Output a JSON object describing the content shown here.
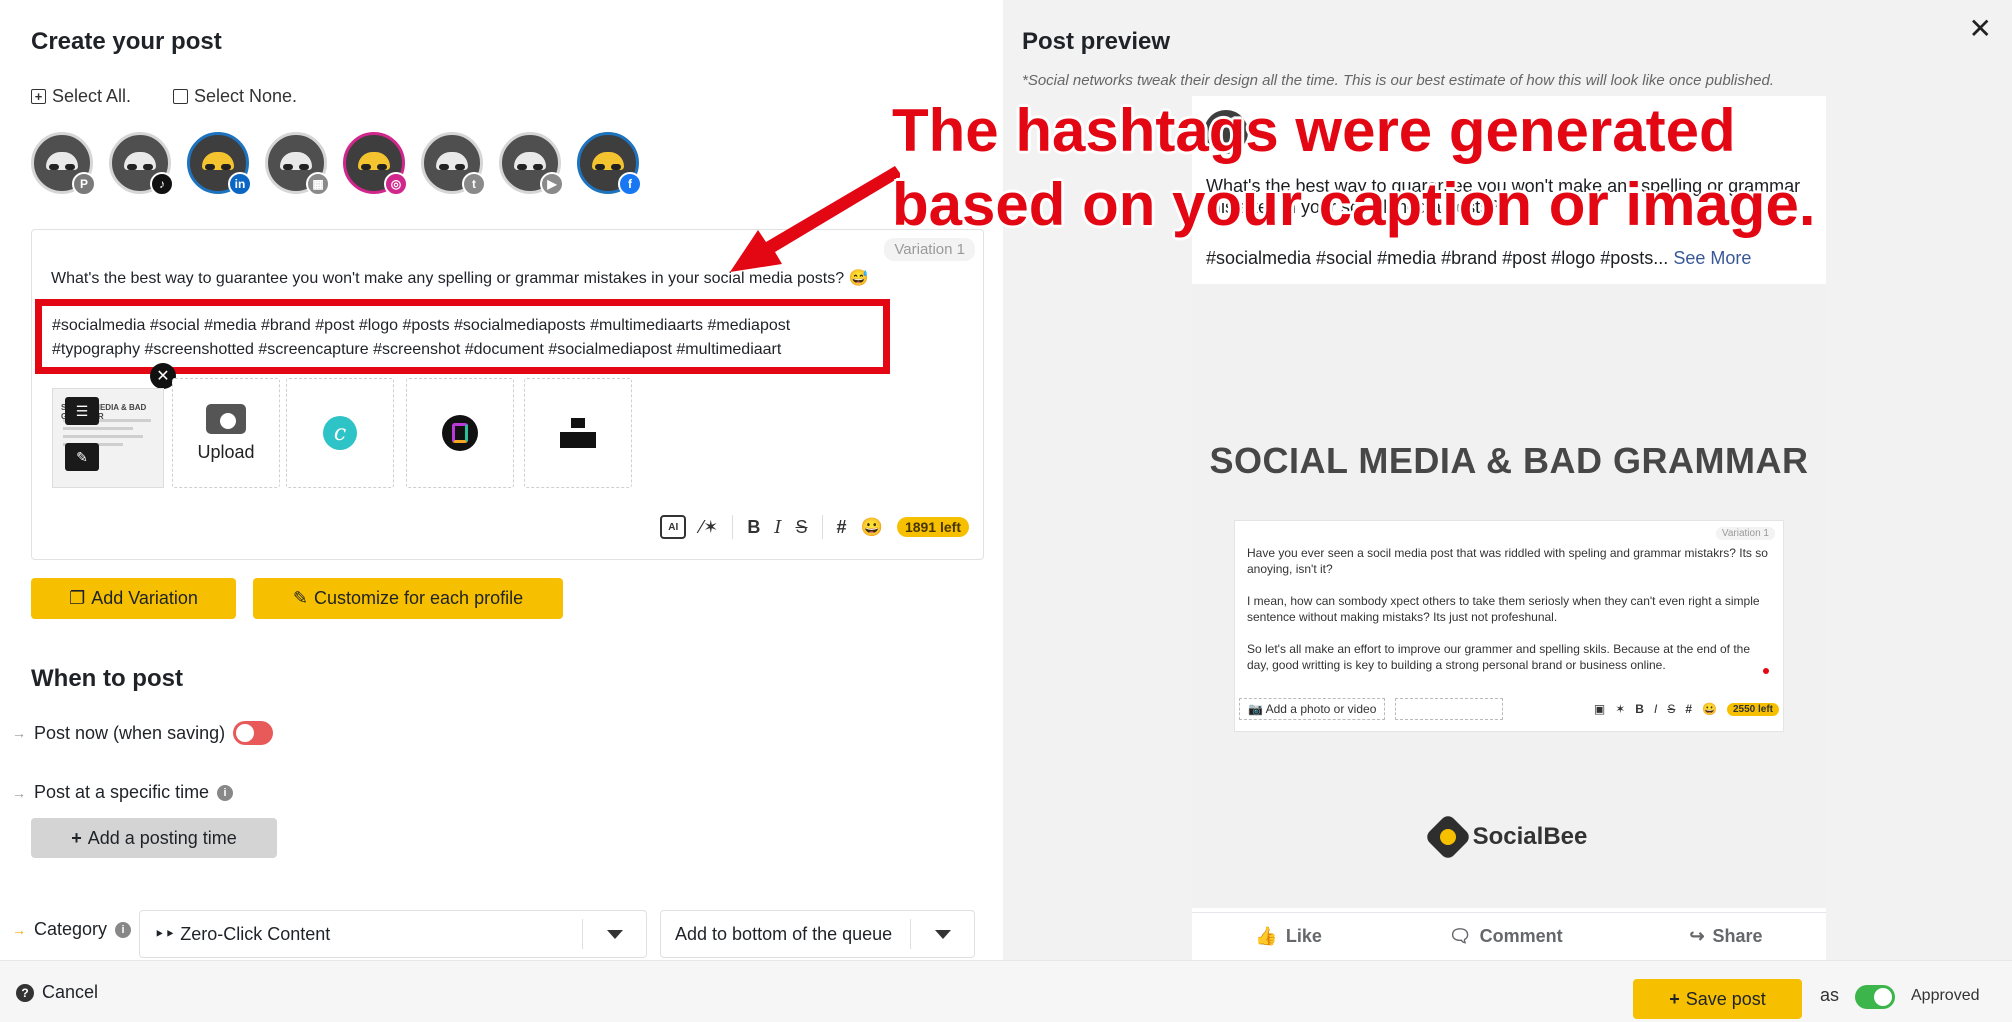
{
  "editor": {
    "title": "Create your post",
    "select_all": "Select All.",
    "select_none": "Select None.",
    "profiles": [
      {
        "network": "pinterest-icon",
        "badge": "P",
        "color": "#7a7a7a",
        "selected": false
      },
      {
        "network": "tiktok-icon",
        "badge": "♪",
        "color": "#111111",
        "selected": false
      },
      {
        "network": "linkedin-icon",
        "badge": "in",
        "color": "#0a66c2",
        "selected": true
      },
      {
        "network": "google-business-icon",
        "badge": "▦",
        "color": "#8a8a8a",
        "selected": false
      },
      {
        "network": "instagram-icon",
        "badge": "◎",
        "color": "#d1268c",
        "selected": true
      },
      {
        "network": "twitter-icon",
        "badge": "t",
        "color": "#8a8a8a",
        "selected": false
      },
      {
        "network": "youtube-icon",
        "badge": "▶",
        "color": "#8a8a8a",
        "selected": false
      },
      {
        "network": "facebook-icon",
        "badge": "f",
        "color": "#1877f2",
        "selected": true
      }
    ],
    "variation_label": "Variation 1",
    "caption": "What's the best way to guarantee you won't make any spelling or grammar mistakes in your social media posts? 😅",
    "hashtags_line1": "#socialmedia #social #media #brand #post #logo #posts #socialmediaposts #multimediaarts #mediapost",
    "hashtags_line2": "#typography #screenshotted #screencapture #screenshot #document #socialmediapost #multimediaart",
    "upload_label": "Upload",
    "chars_left": "1891 left",
    "add_variation": "Add Variation",
    "customize": "Customize for each profile"
  },
  "when": {
    "title": "When to post",
    "post_now": "Post now (when saving)",
    "post_specific": "Post at a specific time",
    "add_time": "Add a posting time",
    "category_label": "Category",
    "category_value": "‣‣ Zero-Click Content",
    "queue_value": "Add to bottom of the queue"
  },
  "preview": {
    "title": "Post preview",
    "note": "*Social networks tweak their design all the time. This is our best estimate of how this will look like once published.",
    "caption": "What's the best way to guarantee you won't make any spelling or grammar mistakes in your social media posts?",
    "tags": "#socialmedia #social #media #brand #post #logo #posts...",
    "see_more": "See More",
    "image_title": "SOCIAL MEDIA & BAD GRAMMAR",
    "mock_variation": "Variation 1",
    "mock_p1": "Have you ever seen a socil media post that was riddled with speling and grammar mistakrs? Its so anoying, isn't it?",
    "mock_p2": "I mean, how can sombody xpect others to take them seriosly when they can't even right a simple sentence without making mistaks? Its just not profeshunal.",
    "mock_p3": "So let's all make an effort to improve our grammer and spelling skils. Because at the end of the day, good writting is key to building a strong personal brand or business online.",
    "mock_photo": "Add a photo or video",
    "mock_count": "2550 left",
    "brand": "SocialBee",
    "like": "Like",
    "comment": "Comment",
    "share": "Share"
  },
  "annotation": {
    "line1": "The hashtags were generated",
    "line2": "based on your caption or image.",
    "color": "#e30613"
  },
  "footer": {
    "cancel": "Cancel",
    "save": "Save post",
    "as": "as",
    "approved": "Approved"
  }
}
